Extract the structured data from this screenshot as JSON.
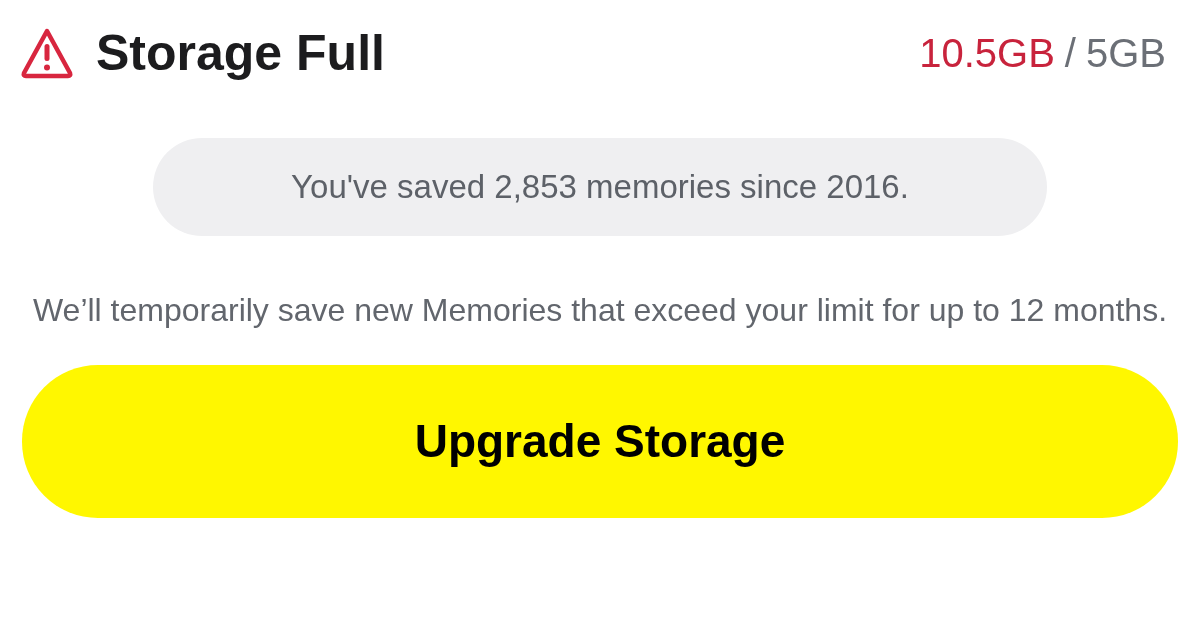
{
  "header": {
    "title": "Storage Full",
    "usage": {
      "used": "10.5GB",
      "separator": "/",
      "limit": "5GB"
    }
  },
  "summary": "You've saved 2,853 memories since 2016.",
  "notice": "We’ll temporarily save new Memories that exceed your limit for up to 12 months.",
  "button": "Upgrade Storage"
}
